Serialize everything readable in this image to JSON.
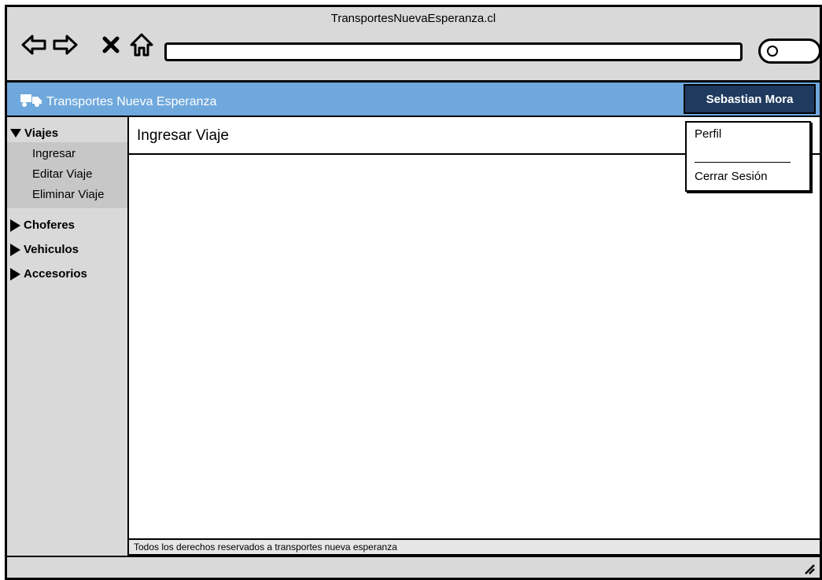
{
  "window": {
    "title": "TransportesNuevaEsperanza.cl"
  },
  "browser": {
    "icons": [
      "back-arrow-icon",
      "forward-arrow-icon",
      "close-x-icon",
      "home-icon",
      "search-icon"
    ],
    "url_value": ""
  },
  "topbar": {
    "brand": "Transportes Nueva Esperanza",
    "brand_icon": "truck-icon",
    "user_name": "Sebastian Mora",
    "bg_color": "#6fa8dc",
    "user_bg_color": "#1f3a5f"
  },
  "user_menu": {
    "items": [
      "Perfil",
      "Cerrar Sesión"
    ]
  },
  "sidebar": {
    "groups": [
      {
        "label": "Viajes",
        "expanded": true,
        "items": [
          "Ingresar",
          "Editar Viaje",
          "Eliminar Viaje"
        ]
      },
      {
        "label": "Choferes",
        "expanded": false
      },
      {
        "label": "Vehiculos",
        "expanded": false
      },
      {
        "label": "Accesorios",
        "expanded": false
      }
    ]
  },
  "main": {
    "title": "Ingresar Viaje"
  },
  "footer": {
    "text": "Todos los derechos reservados a transportes nueva esperanza"
  }
}
